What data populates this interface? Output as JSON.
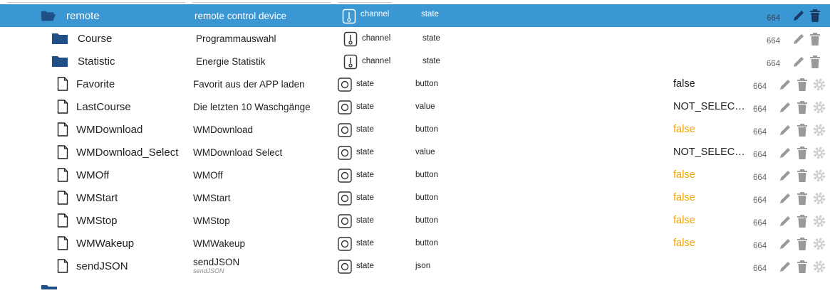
{
  "colors": {
    "selected_bg": "#3a97d3",
    "folder": "#1f4f86",
    "highlight_value": "#f0a500"
  },
  "rows": [
    {
      "name": "remote",
      "description": "remote control device",
      "type": "channel",
      "role": "state",
      "value": "",
      "acl": "664",
      "kind": "folder-open",
      "selected": true
    },
    {
      "name": "Course",
      "description": "Programmauswahl",
      "type": "channel",
      "role": "state",
      "value": "",
      "acl": "664",
      "kind": "folder"
    },
    {
      "name": "Statistic",
      "description": "Energie Statistik",
      "type": "channel",
      "role": "state",
      "value": "",
      "acl": "664",
      "kind": "folder"
    },
    {
      "name": "Favorite",
      "description": "Favorit aus der APP laden",
      "type": "state",
      "role": "button",
      "value": "false",
      "acl": "664",
      "kind": "file"
    },
    {
      "name": "LastCourse",
      "description": "Die letzten 10 Waschgänge",
      "type": "state",
      "role": "value",
      "value": "NOT_SELEC…",
      "acl": "664",
      "kind": "file"
    },
    {
      "name": "WMDownload",
      "description": "WMDownload",
      "type": "state",
      "role": "button",
      "value": "false",
      "acl": "664",
      "kind": "file",
      "value_highlight": true
    },
    {
      "name": "WMDownload_Select",
      "description": "WMDownload Select",
      "type": "state",
      "role": "value",
      "value": "NOT_SELEC…",
      "acl": "664",
      "kind": "file"
    },
    {
      "name": "WMOff",
      "description": "WMOff",
      "type": "state",
      "role": "button",
      "value": "false",
      "acl": "664",
      "kind": "file",
      "value_highlight": true
    },
    {
      "name": "WMStart",
      "description": "WMStart",
      "type": "state",
      "role": "button",
      "value": "false",
      "acl": "664",
      "kind": "file",
      "value_highlight": true
    },
    {
      "name": "WMStop",
      "description": "WMStop",
      "type": "state",
      "role": "button",
      "value": "false",
      "acl": "664",
      "kind": "file",
      "value_highlight": true
    },
    {
      "name": "WMWakeup",
      "description": "WMWakeup",
      "type": "state",
      "role": "button",
      "value": "false",
      "acl": "664",
      "kind": "file",
      "value_highlight": true
    },
    {
      "name": "sendJSON",
      "description": "sendJSON",
      "description_sub": "sendJSON",
      "type": "state",
      "role": "json",
      "value": "",
      "acl": "664",
      "kind": "file"
    }
  ],
  "icons": {
    "folder": "folder-icon",
    "folder_open": "folder-open-icon",
    "file": "file-icon",
    "channel": "channel-icon",
    "state": "state-icon",
    "edit": "edit-icon",
    "delete": "delete-icon",
    "settings": "settings-icon"
  }
}
